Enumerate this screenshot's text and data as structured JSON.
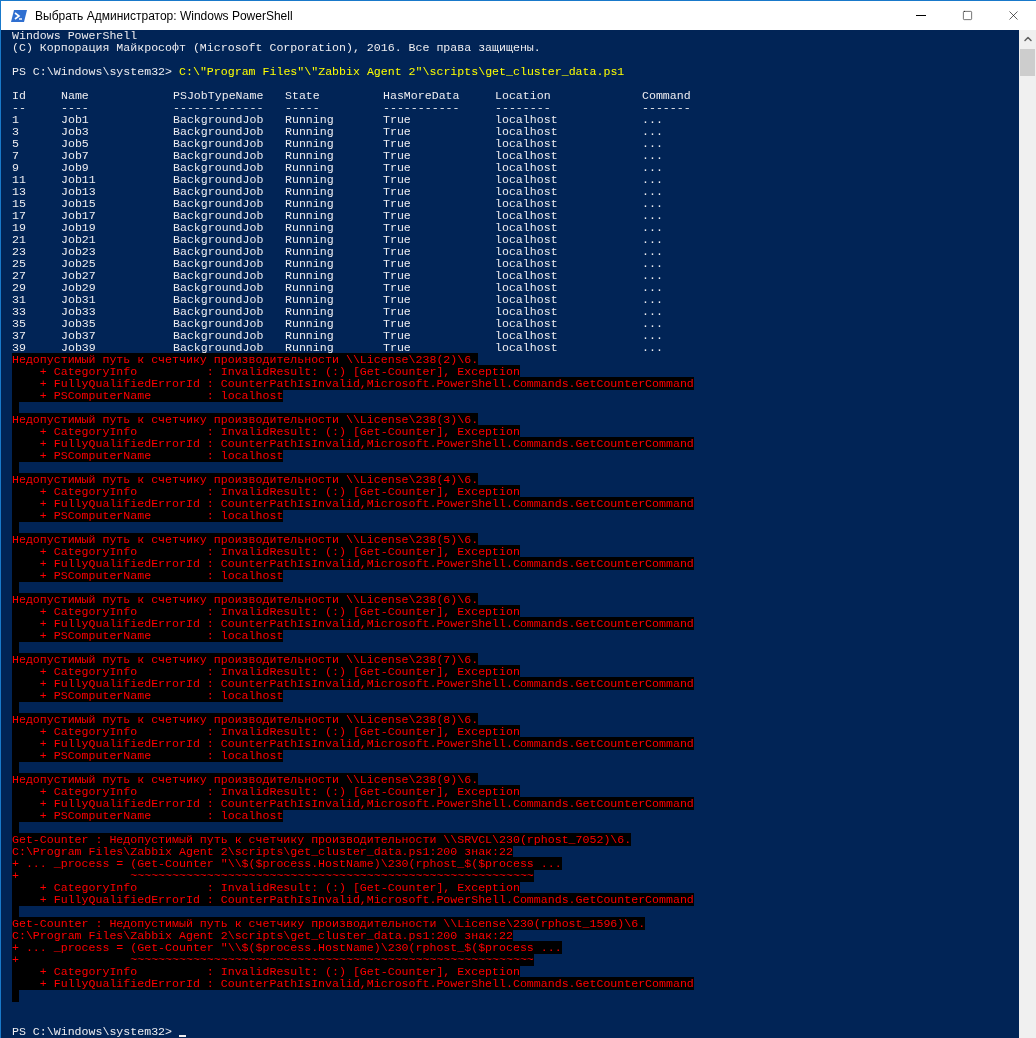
{
  "window": {
    "title": "Выбрать Администратор: Windows PowerShell"
  },
  "console": {
    "banner": [
      "Windows PowerShell",
      "(C) Корпорация Майкрософт (Microsoft Corporation), 2016. Все права защищены."
    ],
    "command": {
      "prompt": "PS C:\\Windows\\system32>",
      "text": "C:\\\"Program Files\"\\\"Zabbix Agent 2\"\\scripts\\get_cluster_data.ps1"
    },
    "jobs_table": {
      "columns": [
        {
          "label": "Id",
          "rule": "--"
        },
        {
          "label": "Name",
          "rule": "----"
        },
        {
          "label": "PSJobTypeName",
          "rule": "-------------"
        },
        {
          "label": "State",
          "rule": "-----"
        },
        {
          "label": "HasMoreData",
          "rule": "-----------"
        },
        {
          "label": "Location",
          "rule": "--------"
        },
        {
          "label": "Command",
          "rule": "-------"
        }
      ],
      "rows": [
        [
          "1",
          "Job1",
          "BackgroundJob",
          "Running",
          "True",
          "localhost",
          "..."
        ],
        [
          "3",
          "Job3",
          "BackgroundJob",
          "Running",
          "True",
          "localhost",
          "..."
        ],
        [
          "5",
          "Job5",
          "BackgroundJob",
          "Running",
          "True",
          "localhost",
          "..."
        ],
        [
          "7",
          "Job7",
          "BackgroundJob",
          "Running",
          "True",
          "localhost",
          "..."
        ],
        [
          "9",
          "Job9",
          "BackgroundJob",
          "Running",
          "True",
          "localhost",
          "..."
        ],
        [
          "11",
          "Job11",
          "BackgroundJob",
          "Running",
          "True",
          "localhost",
          "..."
        ],
        [
          "13",
          "Job13",
          "BackgroundJob",
          "Running",
          "True",
          "localhost",
          "..."
        ],
        [
          "15",
          "Job15",
          "BackgroundJob",
          "Running",
          "True",
          "localhost",
          "..."
        ],
        [
          "17",
          "Job17",
          "BackgroundJob",
          "Running",
          "True",
          "localhost",
          "..."
        ],
        [
          "19",
          "Job19",
          "BackgroundJob",
          "Running",
          "True",
          "localhost",
          "..."
        ],
        [
          "21",
          "Job21",
          "BackgroundJob",
          "Running",
          "True",
          "localhost",
          "..."
        ],
        [
          "23",
          "Job23",
          "BackgroundJob",
          "Running",
          "True",
          "localhost",
          "..."
        ],
        [
          "25",
          "Job25",
          "BackgroundJob",
          "Running",
          "True",
          "localhost",
          "..."
        ],
        [
          "27",
          "Job27",
          "BackgroundJob",
          "Running",
          "True",
          "localhost",
          "..."
        ],
        [
          "29",
          "Job29",
          "BackgroundJob",
          "Running",
          "True",
          "localhost",
          "..."
        ],
        [
          "31",
          "Job31",
          "BackgroundJob",
          "Running",
          "True",
          "localhost",
          "..."
        ],
        [
          "33",
          "Job33",
          "BackgroundJob",
          "Running",
          "True",
          "localhost",
          "..."
        ],
        [
          "35",
          "Job35",
          "BackgroundJob",
          "Running",
          "True",
          "localhost",
          "..."
        ],
        [
          "37",
          "Job37",
          "BackgroundJob",
          "Running",
          "True",
          "localhost",
          "..."
        ],
        [
          "39",
          "Job39",
          "BackgroundJob",
          "Running",
          "True",
          "localhost",
          "..."
        ]
      ]
    },
    "errors": [
      {
        "lines": [
          "Недопустимый путь к счетчику производительности \\\\License\\238(2)\\6.",
          "    + CategoryInfo          : InvalidResult: (:) [Get-Counter], Exception",
          "    + FullyQualifiedErrorId : CounterPathIsInvalid,Microsoft.PowerShell.Commands.GetCounterCommand",
          "    + PSComputerName        : localhost"
        ]
      },
      {
        "lines": [
          "Недопустимый путь к счетчику производительности \\\\License\\238(3)\\6.",
          "    + CategoryInfo          : InvalidResult: (:) [Get-Counter], Exception",
          "    + FullyQualifiedErrorId : CounterPathIsInvalid,Microsoft.PowerShell.Commands.GetCounterCommand",
          "    + PSComputerName        : localhost"
        ]
      },
      {
        "lines": [
          "Недопустимый путь к счетчику производительности \\\\License\\238(4)\\6.",
          "    + CategoryInfo          : InvalidResult: (:) [Get-Counter], Exception",
          "    + FullyQualifiedErrorId : CounterPathIsInvalid,Microsoft.PowerShell.Commands.GetCounterCommand",
          "    + PSComputerName        : localhost"
        ]
      },
      {
        "lines": [
          "Недопустимый путь к счетчику производительности \\\\License\\238(5)\\6.",
          "    + CategoryInfo          : InvalidResult: (:) [Get-Counter], Exception",
          "    + FullyQualifiedErrorId : CounterPathIsInvalid,Microsoft.PowerShell.Commands.GetCounterCommand",
          "    + PSComputerName        : localhost"
        ]
      },
      {
        "lines": [
          "Недопустимый путь к счетчику производительности \\\\License\\238(6)\\6.",
          "    + CategoryInfo          : InvalidResult: (:) [Get-Counter], Exception",
          "    + FullyQualifiedErrorId : CounterPathIsInvalid,Microsoft.PowerShell.Commands.GetCounterCommand",
          "    + PSComputerName        : localhost"
        ]
      },
      {
        "lines": [
          "Недопустимый путь к счетчику производительности \\\\License\\238(7)\\6.",
          "    + CategoryInfo          : InvalidResult: (:) [Get-Counter], Exception",
          "    + FullyQualifiedErrorId : CounterPathIsInvalid,Microsoft.PowerShell.Commands.GetCounterCommand",
          "    + PSComputerName        : localhost"
        ]
      },
      {
        "lines": [
          "Недопустимый путь к счетчику производительности \\\\License\\238(8)\\6.",
          "    + CategoryInfo          : InvalidResult: (:) [Get-Counter], Exception",
          "    + FullyQualifiedErrorId : CounterPathIsInvalid,Microsoft.PowerShell.Commands.GetCounterCommand",
          "    + PSComputerName        : localhost"
        ]
      },
      {
        "lines": [
          "Недопустимый путь к счетчику производительности \\\\License\\238(9)\\6.",
          "    + CategoryInfo          : InvalidResult: (:) [Get-Counter], Exception",
          "    + FullyQualifiedErrorId : CounterPathIsInvalid,Microsoft.PowerShell.Commands.GetCounterCommand",
          "    + PSComputerName        : localhost"
        ]
      },
      {
        "lines": [
          "Get-Counter : Недопустимый путь к счетчику производительности \\\\SRVCL\\230(rphost_7052)\\6.",
          "C:\\Program Files\\Zabbix Agent 2\\scripts\\get_cluster_data.ps1:200 знак:22",
          "+ ... _process = (Get-Counter \"\\\\$($process.HostName)\\230(rphost_$($process ...",
          "+                ~~~~~~~~~~~~~~~~~~~~~~~~~~~~~~~~~~~~~~~~~~~~~~~~~~~~~~~~~~",
          "    + CategoryInfo          : InvalidResult: (:) [Get-Counter], Exception",
          "    + FullyQualifiedErrorId : CounterPathIsInvalid,Microsoft.PowerShell.Commands.GetCounterCommand"
        ]
      },
      {
        "lines": [
          "Get-Counter : Недопустимый путь к счетчику производительности \\\\License\\230(rphost_1596)\\6.",
          "C:\\Program Files\\Zabbix Agent 2\\scripts\\get_cluster_data.ps1:200 знак:22",
          "+ ... _process = (Get-Counter \"\\\\$($process.HostName)\\230(rphost_$($process ...",
          "+                ~~~~~~~~~~~~~~~~~~~~~~~~~~~~~~~~~~~~~~~~~~~~~~~~~~~~~~~~~~",
          "    + CategoryInfo          : InvalidResult: (:) [Get-Counter], Exception",
          "    + FullyQualifiedErrorId : CounterPathIsInvalid,Microsoft.PowerShell.Commands.GetCounterCommand"
        ]
      }
    ],
    "prompt": "PS C:\\Windows\\system32>"
  }
}
